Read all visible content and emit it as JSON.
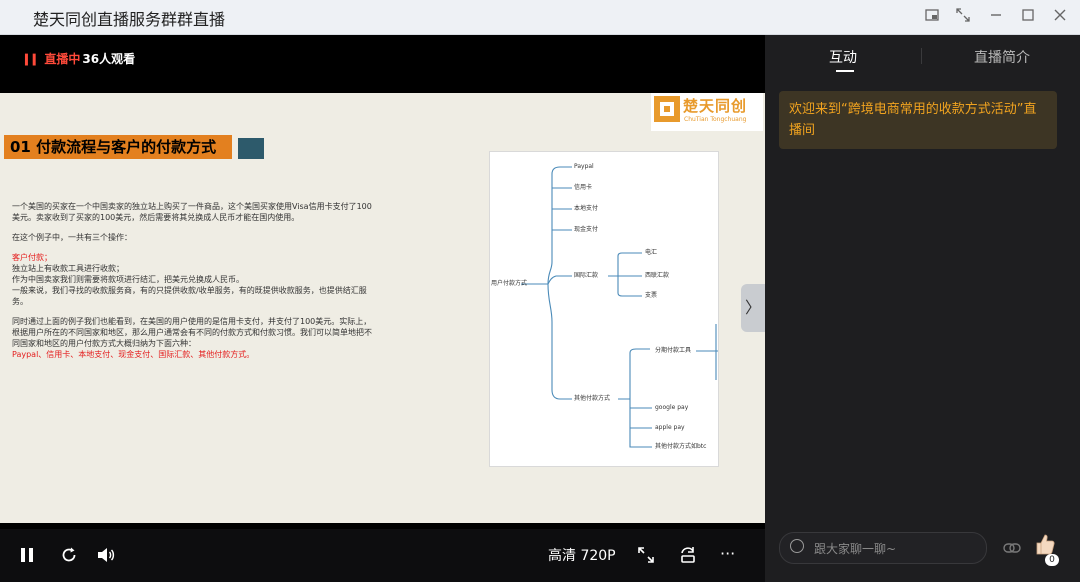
{
  "window": {
    "title": "楚天同创直播服务群群直播"
  },
  "video": {
    "live_label": "直播中",
    "viewers": "36人观看",
    "slide": {
      "logo_cn": "楚天同创",
      "logo_en": "ChuTian Tongchuang",
      "title": "01 付款流程与客户的付款方式",
      "paragraphs": {
        "p1": "一个美国的买家在一个中国卖家的独立站上购买了一件商品，这个美国买家使用Visa信用卡支付了100美元。卖家收到了买家的100美元，然后需要将其兑换成人民币才能在国内使用。",
        "p2": "在这个例子中，一共有三个操作：",
        "p3_red": "客户付款；",
        "p3_l2": "独立站上有收款工具进行收款；",
        "p3_l3": "作为中国卖家我们则需要将款项进行结汇，把美元兑换成人民币。",
        "p3_l4": "一般来说，我们寻找的收款服务商，有的只提供收款/收单服务，有的既提供收款服务，也提供结汇服务。",
        "p4": "同时通过上面的例子我们也能看到，在美国的用户使用的是信用卡支付，并支付了100美元。实际上，根据用户所在的不同国家和地区，那么用户通常会有不同的付款方式和付款习惯。我们可以简单地把不同国家和地区的用户付款方式大概归纳为下面六种：",
        "p5_red": "Paypal、信用卡、本地支付、现金支付、国际汇款、其他付款方式。"
      },
      "diagram": {
        "root": "用户付款方式",
        "branches": [
          "Paypal",
          "信用卡",
          "本地支付",
          "现金支付",
          "国际汇款",
          "其他付款方式"
        ],
        "intl": [
          "电汇",
          "西联汇款",
          "支票"
        ],
        "other": [
          "分期付款工具",
          "google pay",
          "apple pay",
          "其他付款方式如btc"
        ]
      }
    },
    "controls": {
      "quality": "高清 720P"
    }
  },
  "sidebar": {
    "tabs": [
      "互动",
      "直播简介"
    ],
    "welcome": "欢迎来到“跨境电商常用的收款方式活动”直播间",
    "chat_placeholder": "跟大家聊一聊~",
    "like_count": "0"
  },
  "colors": {
    "accent": "#f1a31f",
    "live": "#ff4a3a",
    "slide_title": "#e3801f",
    "diagram_line": "#4a8ab8"
  }
}
